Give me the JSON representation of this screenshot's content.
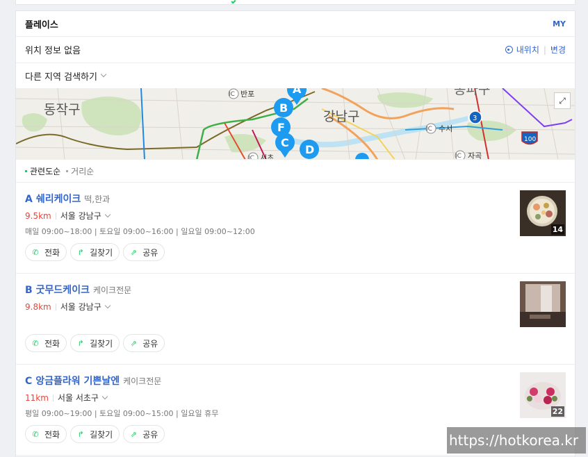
{
  "header": {
    "title": "플레이스",
    "my_label": "MY"
  },
  "location": {
    "status": "위치 정보 없음",
    "my_location_label": "내위치",
    "change_label": "변경"
  },
  "search_other": {
    "label": "다른 지역 검색하기"
  },
  "map": {
    "labels": {
      "dongjak": "동작구",
      "gangnam": "강남구",
      "banpo": "반포",
      "suseo": "수서",
      "seocho": "서초",
      "jagok": "자곡",
      "songpa_partial": "송파구",
      "ic": "IC",
      "route3": "3",
      "route100": "100"
    },
    "markers": [
      "A",
      "B",
      "F",
      "C",
      "D"
    ]
  },
  "sort": {
    "options": [
      "관련도순",
      "거리순"
    ],
    "selected": "관련도순"
  },
  "buttons": {
    "call": "전화",
    "directions": "길찾기",
    "share": "공유"
  },
  "places": [
    {
      "letter": "A",
      "name": "쉐리케이크",
      "category": "떡,한과",
      "distance": "9.5km",
      "address": "서울 강남구",
      "hours": "매일 09:00~18:00 | 토요일 09:00~16:00 | 일요일 09:00~12:00",
      "photo_count": "14"
    },
    {
      "letter": "B",
      "name": "굿무드케이크",
      "category": "케이크전문",
      "distance": "9.8km",
      "address": "서울 강남구",
      "hours": "",
      "photo_count": ""
    },
    {
      "letter": "C",
      "name": "앙금플라워 기쁜날엔",
      "category": "케이크전문",
      "distance": "11km",
      "address": "서울 서초구",
      "hours": "평일 09:00~19:00 | 토요일 09:00~15:00 | 일요일 휴무",
      "photo_count": "22"
    }
  ],
  "watermark": "https://hotkorea.kr",
  "colors": {
    "link": "#3366cc",
    "distance": "#e8443a",
    "accent": "#19ce60",
    "marker": "#1d9bf0"
  }
}
